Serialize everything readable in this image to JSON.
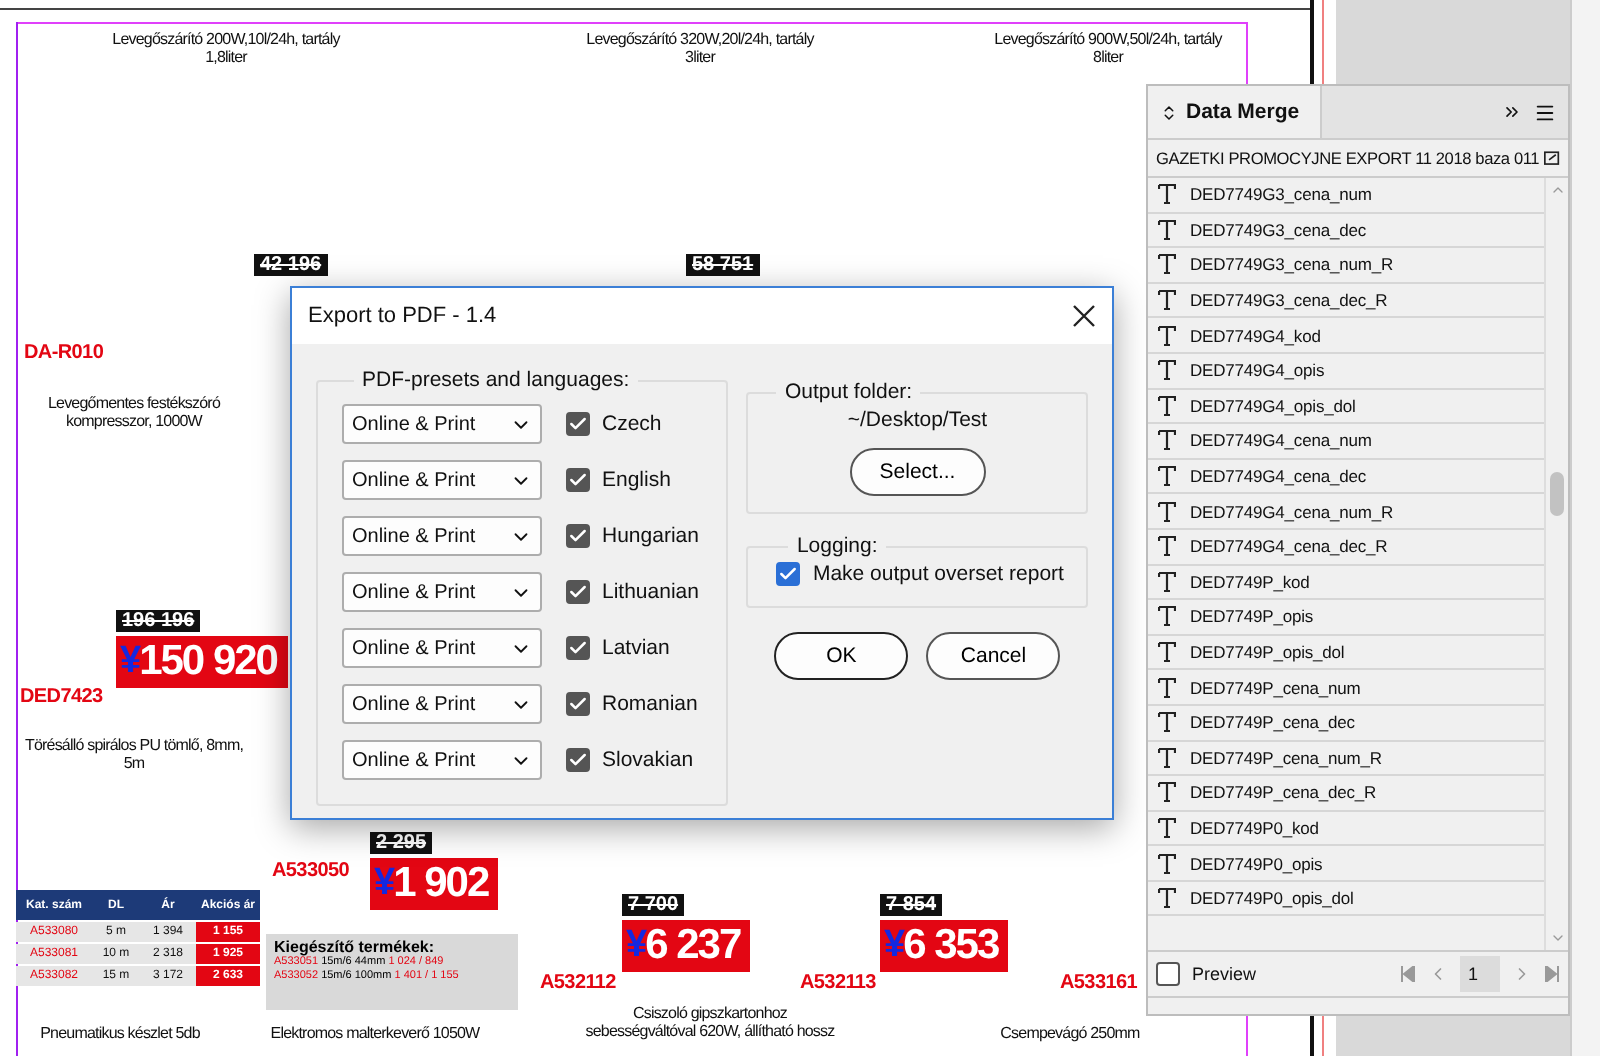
{
  "canvas": {
    "product_titles": [
      "Levegőszárító 200W,10l/24h, tartály 1,8liter",
      "Levegőszárító 320W,20l/24h, tartály 3liter",
      "Levegőszárító 900W,50l/24h, tartály 8liter",
      "Levegőmentes festékszóró kompresszor, 1000W",
      "Törésálló spirálos PU tömlő, 8mm, 5m",
      "Pneumatikus készlet 5db",
      "Elektromos malterkeverő 1050W",
      "Csiszoló gipszkartonhoz sebességváltóval 620W, állítható hossz",
      "Csempevágó 250mm"
    ],
    "codes": [
      "DA-R010",
      "DED7423",
      "A533050",
      "A532112",
      "A532113",
      "A533161"
    ],
    "prices": [
      {
        "old": "42 196"
      },
      {
        "old": "58 751"
      },
      {
        "old": "196 196",
        "currency": "¥",
        "new": "150 920"
      },
      {
        "old": "2 295",
        "currency": "¥",
        "new": "1 902"
      },
      {
        "old": "7 700",
        "currency": "¥",
        "new": "6 237"
      },
      {
        "old": "7 854",
        "currency": "¥",
        "new": "6 353"
      }
    ],
    "table": {
      "columns": [
        "Kat. szám",
        "DL",
        "Ár",
        "Akciós ár"
      ],
      "rows": [
        [
          "A533080",
          "5 m",
          "1 394",
          "1 155"
        ],
        [
          "A533081",
          "10 m",
          "2 318",
          "1 925"
        ],
        [
          "A533082",
          "15 m",
          "3 172",
          "2 633"
        ]
      ]
    },
    "accessories": {
      "title": "Kiegészítő termékek:",
      "items": [
        {
          "code": "A533051",
          "text": "15m/6 44mm",
          "prices": "1 024 / 849"
        },
        {
          "code": "A533052",
          "text": "15m/6 100mm",
          "prices": "1 401 / 1 155"
        }
      ]
    }
  },
  "dialog": {
    "title": "Export to PDF - 1.4",
    "presets_label": "PDF-presets and languages:",
    "presets": [
      {
        "preset": "Online & Print",
        "language": "Czech",
        "checked": true
      },
      {
        "preset": "Online & Print",
        "language": "English",
        "checked": true
      },
      {
        "preset": "Online & Print",
        "language": "Hungarian",
        "checked": true
      },
      {
        "preset": "Online & Print",
        "language": "Lithuanian",
        "checked": true
      },
      {
        "preset": "Online & Print",
        "language": "Latvian",
        "checked": true
      },
      {
        "preset": "Online & Print",
        "language": "Romanian",
        "checked": true
      },
      {
        "preset": "Online & Print",
        "language": "Slovakian",
        "checked": true
      }
    ],
    "output_folder": {
      "label": "Output folder:",
      "path": "~/Desktop/Test",
      "button": "Select..."
    },
    "logging": {
      "label": "Logging:",
      "option": "Make output overset report",
      "checked": true
    },
    "buttons": [
      "OK",
      "Cancel"
    ]
  },
  "panel": {
    "tab": "Data Merge",
    "source": "GAZETKI PROMOCYJNE EXPORT 11 2018 baza 011",
    "fields": [
      "DED7749G3_cena_num",
      "DED7749G3_cena_dec",
      "DED7749G3_cena_num_R",
      "DED7749G3_cena_dec_R",
      "DED7749G4_kod",
      "DED7749G4_opis",
      "DED7749G4_opis_dol",
      "DED7749G4_cena_num",
      "DED7749G4_cena_dec",
      "DED7749G4_cena_num_R",
      "DED7749G4_cena_dec_R",
      "DED7749P_kod",
      "DED7749P_opis",
      "DED7749P_opis_dol",
      "DED7749P_cena_num",
      "DED7749P_cena_dec",
      "DED7749P_cena_num_R",
      "DED7749P_cena_dec_R",
      "DED7749P0_kod",
      "DED7749P0_opis",
      "DED7749P0_opis_dol"
    ],
    "preview": {
      "label": "Preview",
      "checked": false
    },
    "page": "1"
  }
}
